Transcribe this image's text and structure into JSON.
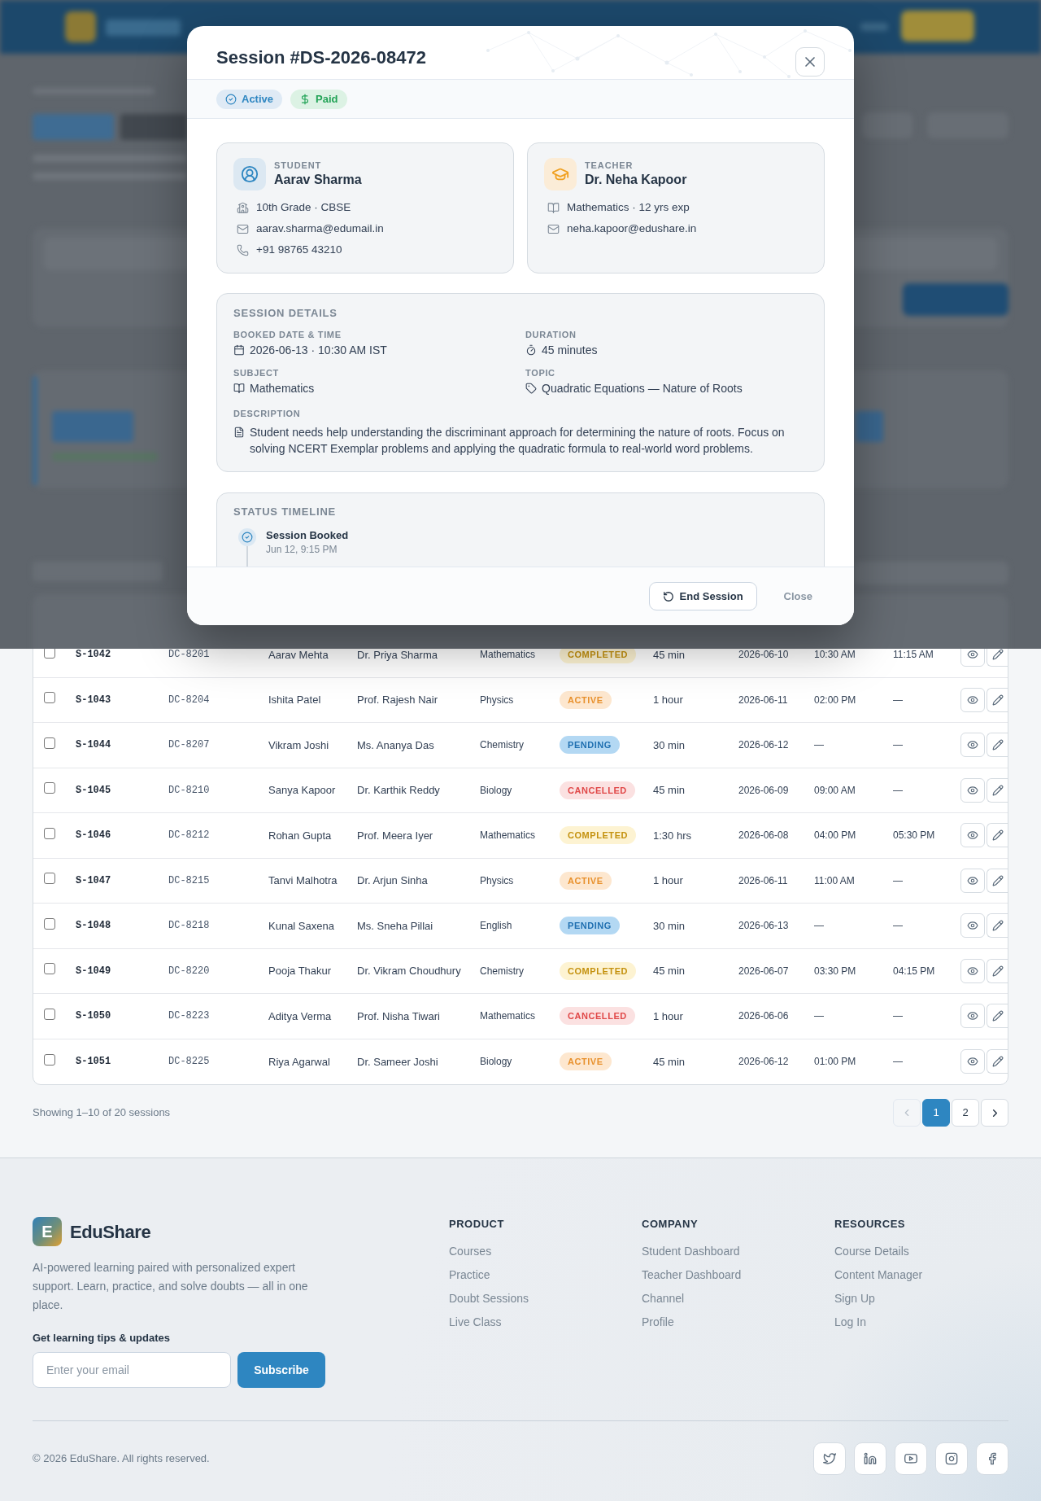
{
  "modal": {
    "title": "Session #DS-2026-08472",
    "badges": [
      {
        "label": "Active",
        "kind": "status"
      },
      {
        "label": "Paid",
        "kind": "payment"
      }
    ],
    "people": [
      {
        "kind": "student",
        "role": "STUDENT",
        "name": "Aarav Sharma",
        "details": [
          {
            "kind": "grade",
            "text": "10th Grade · CBSE"
          },
          {
            "kind": "email",
            "text": "aarav.sharma@edumail.in"
          },
          {
            "kind": "phone",
            "text": "+91 98765 43210"
          }
        ]
      },
      {
        "kind": "teacher",
        "role": "TEACHER",
        "name": "Dr. Neha Kapoor",
        "details": [
          {
            "kind": "subject",
            "text": "Mathematics · 12 yrs exp"
          },
          {
            "kind": "email",
            "text": "neha.kapoor@edushare.in"
          }
        ]
      }
    ],
    "session_details": {
      "heading": "SESSION DETAILS",
      "fields": [
        {
          "kind": "date",
          "label": "BOOKED DATE & TIME",
          "value": "2026-06-13 · 10:30 AM IST"
        },
        {
          "kind": "duration",
          "label": "DURATION",
          "value": "45 minutes"
        },
        {
          "kind": "subject",
          "label": "SUBJECT",
          "value": "Mathematics"
        },
        {
          "kind": "topic",
          "label": "TOPIC",
          "value": "Quadratic Equations — Nature of Roots"
        }
      ],
      "description": {
        "label": "DESCRIPTION",
        "text": "Student needs help understanding the discriminant approach for determining the nature of roots. Focus on solving NCERT Exemplar problems and applying the quadratic formula to real-world word problems."
      }
    },
    "timeline": {
      "heading": "STATUS TIMELINE",
      "events": [
        {
          "title": "Session Booked",
          "time": "Jun 12, 9:15 PM"
        }
      ]
    },
    "actions": [
      {
        "label": "End Session",
        "kind": "outline"
      },
      {
        "label": "Close",
        "kind": "text"
      }
    ]
  },
  "table": {
    "rows": [
      {
        "checked": false,
        "session_id": "S-1042",
        "doubt_code": "DC-8201",
        "student": "Aarav Mehta",
        "teacher": "Dr. Priya Sharma",
        "subject": "Mathematics",
        "status": {
          "label": "COMPLETED",
          "kind": "completed"
        },
        "duration": "45 min",
        "date": "2026-06-10",
        "start_time": "10:30 AM",
        "end_time": "11:15 AM"
      },
      {
        "checked": false,
        "session_id": "S-1043",
        "doubt_code": "DC-8204",
        "student": "Ishita Patel",
        "teacher": "Prof. Rajesh Nair",
        "subject": "Physics",
        "status": {
          "label": "ACTIVE",
          "kind": "active"
        },
        "duration": "1 hour",
        "date": "2026-06-11",
        "start_time": "02:00 PM",
        "end_time": "—"
      },
      {
        "checked": false,
        "session_id": "S-1044",
        "doubt_code": "DC-8207",
        "student": "Vikram Joshi",
        "teacher": "Ms. Ananya Das",
        "subject": "Chemistry",
        "status": {
          "label": "PENDING",
          "kind": "pending"
        },
        "duration": "30 min",
        "date": "2026-06-12",
        "start_time": "—",
        "end_time": "—"
      },
      {
        "checked": false,
        "session_id": "S-1045",
        "doubt_code": "DC-8210",
        "student": "Sanya Kapoor",
        "teacher": "Dr. Karthik Reddy",
        "subject": "Biology",
        "status": {
          "label": "CANCELLED",
          "kind": "cancelled"
        },
        "duration": "45 min",
        "date": "2026-06-09",
        "start_time": "09:00 AM",
        "end_time": "—"
      },
      {
        "checked": false,
        "session_id": "S-1046",
        "doubt_code": "DC-8212",
        "student": "Rohan Gupta",
        "teacher": "Prof. Meera Iyer",
        "subject": "Mathematics",
        "status": {
          "label": "COMPLETED",
          "kind": "completed"
        },
        "duration": "1:30 hrs",
        "date": "2026-06-08",
        "start_time": "04:00 PM",
        "end_time": "05:30 PM"
      },
      {
        "checked": false,
        "session_id": "S-1047",
        "doubt_code": "DC-8215",
        "student": "Tanvi Malhotra",
        "teacher": "Dr. Arjun Sinha",
        "subject": "Physics",
        "status": {
          "label": "ACTIVE",
          "kind": "active"
        },
        "duration": "1 hour",
        "date": "2026-06-11",
        "start_time": "11:00 AM",
        "end_time": "—"
      },
      {
        "checked": false,
        "session_id": "S-1048",
        "doubt_code": "DC-8218",
        "student": "Kunal Saxena",
        "teacher": "Ms. Sneha Pillai",
        "subject": "English",
        "status": {
          "label": "PENDING",
          "kind": "pending"
        },
        "duration": "30 min",
        "date": "2026-06-13",
        "start_time": "—",
        "end_time": "—"
      },
      {
        "checked": false,
        "session_id": "S-1049",
        "doubt_code": "DC-8220",
        "student": "Pooja Thakur",
        "teacher": "Dr. Vikram Choudhury",
        "subject": "Chemistry",
        "status": {
          "label": "COMPLETED",
          "kind": "completed"
        },
        "duration": "45 min",
        "date": "2026-06-07",
        "start_time": "03:30 PM",
        "end_time": "04:15 PM"
      },
      {
        "checked": false,
        "session_id": "S-1050",
        "doubt_code": "DC-8223",
        "student": "Aditya Verma",
        "teacher": "Prof. Nisha Tiwari",
        "subject": "Mathematics",
        "status": {
          "label": "CANCELLED",
          "kind": "cancelled"
        },
        "duration": "1 hour",
        "date": "2026-06-06",
        "start_time": "—",
        "end_time": "—"
      },
      {
        "checked": false,
        "session_id": "S-1051",
        "doubt_code": "DC-8225",
        "student": "Riya Agarwal",
        "teacher": "Dr. Sameer Joshi",
        "subject": "Biology",
        "status": {
          "label": "ACTIVE",
          "kind": "active"
        },
        "duration": "45 min",
        "date": "2026-06-12",
        "start_time": "01:00 PM",
        "end_time": "—"
      }
    ]
  },
  "pagination": {
    "summary": "Showing 1–10 of 20 sessions",
    "prev": {
      "disabled": true
    },
    "pages": [
      {
        "label": "1",
        "selected": true
      },
      {
        "label": "2",
        "selected": false
      }
    ],
    "next": {
      "disabled": false
    }
  },
  "footer": {
    "brand": {
      "logo_letter": "E",
      "name": "EduShare"
    },
    "description": "AI-powered learning paired with personalized expert support. Learn, practice, and solve doubts — all in one place.",
    "newsletter": {
      "heading": "Get learning tips & updates",
      "placeholder": "Enter your email",
      "button": "Subscribe"
    },
    "columns": [
      {
        "heading": "PRODUCT",
        "links": [
          "Courses",
          "Practice",
          "Doubt Sessions",
          "Live Class"
        ]
      },
      {
        "heading": "COMPANY",
        "links": [
          "Student Dashboard",
          "Teacher Dashboard",
          "Channel",
          "Profile"
        ]
      },
      {
        "heading": "RESOURCES",
        "links": [
          "Course Details",
          "Content Manager",
          "Sign Up",
          "Log In"
        ]
      }
    ],
    "copyright": "© 2026 EduShare. All rights reserved."
  }
}
